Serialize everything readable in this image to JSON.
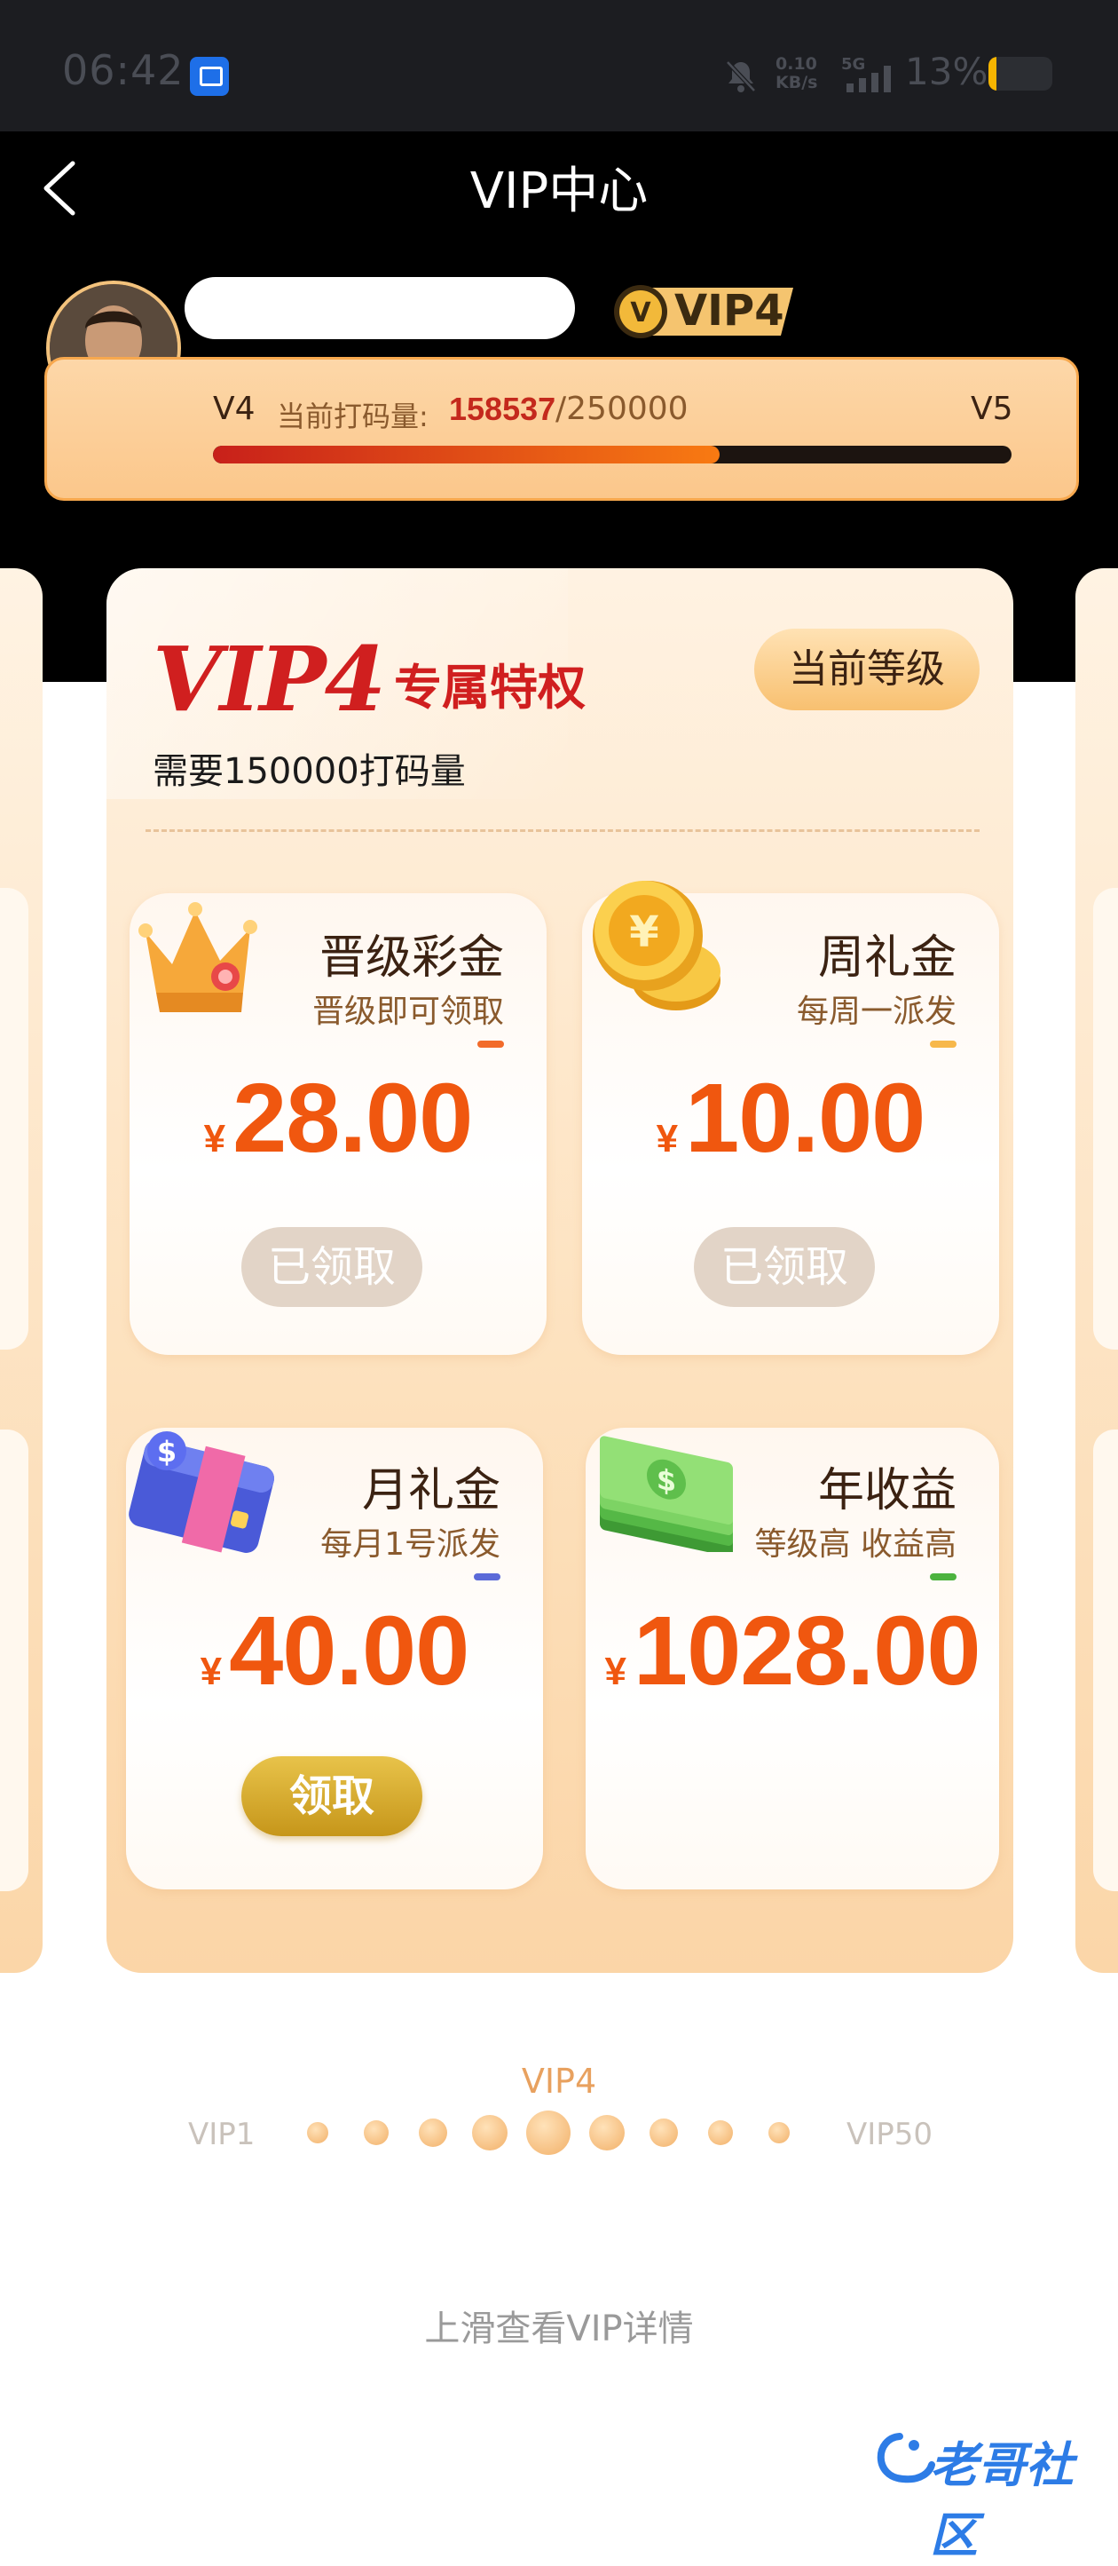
{
  "status_bar": {
    "time": "06:42",
    "net_speed_value": "0.10",
    "net_speed_unit": "KB/s",
    "network": "5G",
    "battery_pct": "13%",
    "battery_level": 0.13
  },
  "header": {
    "title": "VIP中心",
    "badge": "VIP4"
  },
  "progress": {
    "from_level": "V4",
    "label": "当前打码量:",
    "current": "158537",
    "total": "/250000",
    "to_level": "V5",
    "fraction": 0.634
  },
  "card": {
    "logo": "VIP4",
    "subtitle": "专属特权",
    "current_level_button": "当前等级",
    "requirement": "需要150000打码量",
    "benefits": [
      {
        "title": "晋级彩金",
        "subtitle": "晋级即可领取",
        "currency": "¥",
        "amount": "28.00",
        "button": "已领取",
        "bar_color": "#f26b2a",
        "icon": "crown-icon"
      },
      {
        "title": "周礼金",
        "subtitle": "每周一派发",
        "currency": "¥",
        "amount": "10.00",
        "button": "已领取",
        "bar_color": "#f7b84b",
        "icon": "coins-icon"
      },
      {
        "title": "月礼金",
        "subtitle": "每月1号派发",
        "currency": "¥",
        "amount": "40.00",
        "button": "领取",
        "bar_color": "#5b6ad8",
        "icon": "wallet-icon"
      },
      {
        "title": "年收益",
        "subtitle": "等级高 收益高",
        "currency": "¥",
        "amount": "1028.00",
        "bar_color": "#4cb33f",
        "icon": "cash-stack-icon"
      }
    ]
  },
  "level_selector": {
    "current": "VIP4",
    "min": "VIP1",
    "max": "VIP50"
  },
  "swipe_hint": "上滑查看VIP详情",
  "watermark": "老哥社区"
}
